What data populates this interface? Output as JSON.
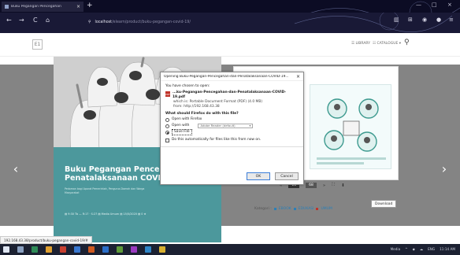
{
  "browser": {
    "tab_title": "Buku Pegangan Pencegahan",
    "tab_close": "×",
    "newtab": "+",
    "win_min": "—",
    "win_max": "□",
    "win_close": "×",
    "back": "←",
    "forward": "→",
    "reload": "C",
    "home": "⌂",
    "search_glyph": "⚲",
    "url_host": "localhost",
    "url_path": "/elearn/product/buku-pegangan-covid-19/",
    "menu": "≡"
  },
  "site": {
    "logo": "E1",
    "nav_library": "☰ LIBRARY",
    "nav_catalogue": "☷ CATALOGUE ▾",
    "search": "⚲"
  },
  "carousel": {
    "prev": "‹",
    "next": "›"
  },
  "cover": {
    "title_line1": "Buku Pegangan Pencegaha",
    "title_line2": "Penatalaksanaan COVID-19",
    "subtitle": "Pedoman bagi Aparat Pemerintah, Pengurus Daerah dan Warga Masyarakat",
    "footer": "▤ 9:30 Tb — R:17 · S:27 ▤ Media Umum ▤ 15/5/2020 ▤ 0 ★"
  },
  "controls": {
    "prev": "«",
    "page_current": "10",
    "page_total": "68",
    "next": "»",
    "fullscreen": "⛶",
    "download_icon": "⬇",
    "download_tooltip": "Download"
  },
  "kategori": {
    "label": "Kategori :",
    "items": [
      "EBOOK",
      "EDUKASI",
      "UMUM"
    ]
  },
  "dialog": {
    "title": "Opening Buku-Pegangan-Pencegahan-dan-Penatalaksanaan-COVID-19...",
    "close": "×",
    "intro": "You have chosen to open:",
    "filename": "...ku-Pegangan-Pencegahan-dan-Penatalaksanaan-COVID-19.pdf",
    "filetype": "which is: Portable Document Format (PDF) (4.0 MB)",
    "from": "from: http://192.168.43.38",
    "question": "What should Firefox do with this file?",
    "opt_firefox": "Open with Firefox",
    "opt_openwith": "Open with",
    "app": "Adobe Reader (default)",
    "opt_save": "Save File",
    "auto": "Do this automatically for files like this from now on.",
    "ok": "OK",
    "cancel": "Cancel"
  },
  "status_url": "192.168.43.38/product/buku-pegangan-covid-19/#",
  "taskbar": {
    "tray": [
      "Media",
      "^",
      "◆",
      "☁",
      "ENG",
      "11:14 AM"
    ]
  }
}
